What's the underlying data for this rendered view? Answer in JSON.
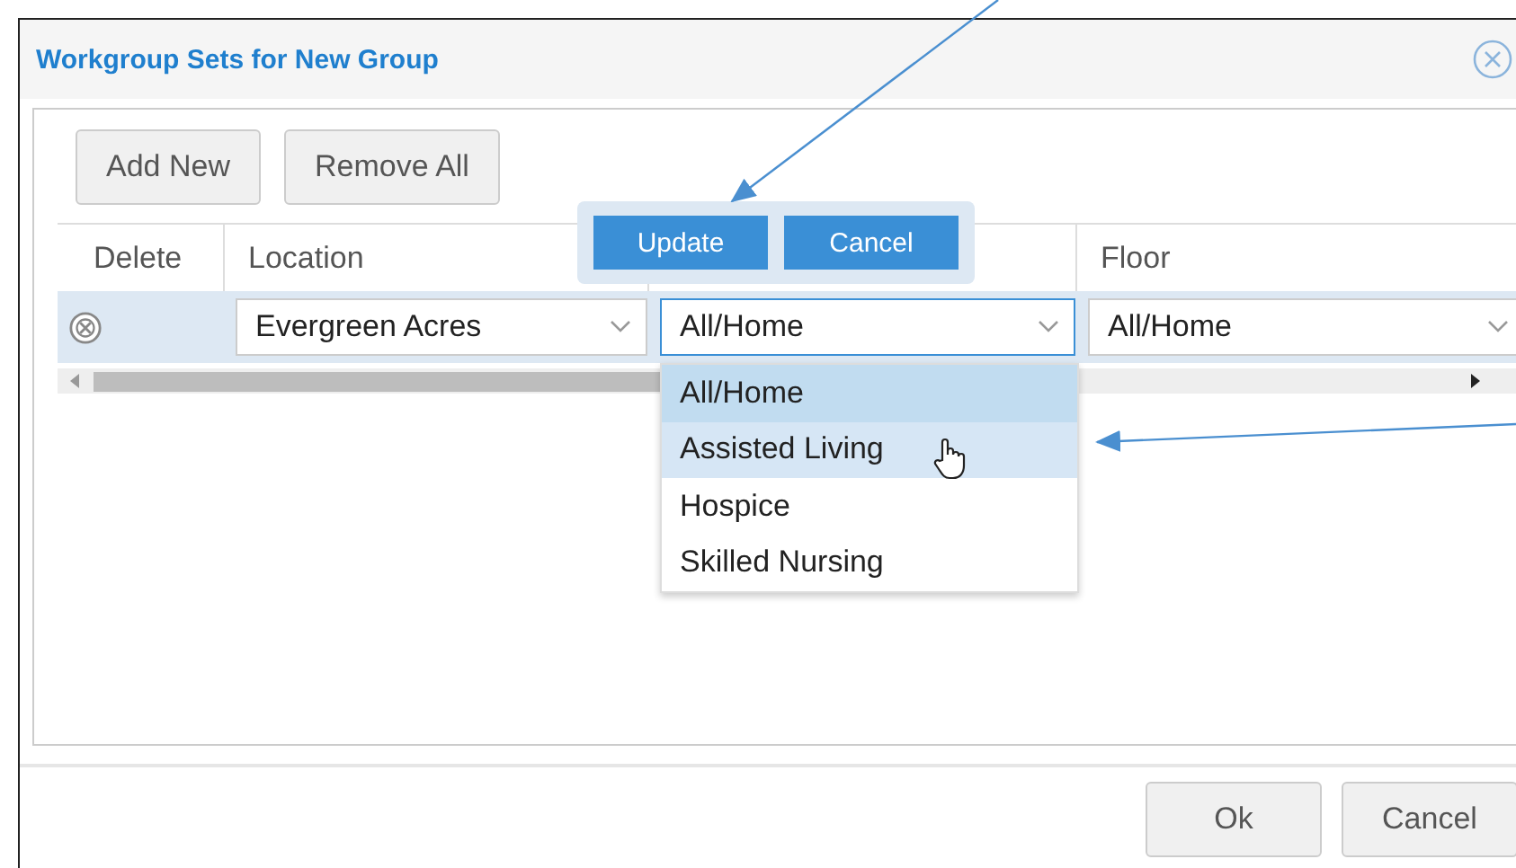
{
  "dialog": {
    "title": "Workgroup Sets for New Group"
  },
  "toolbar": [
    "Add New",
    "Remove All"
  ],
  "table": {
    "columns": [
      {
        "kind": "label",
        "label": "Delete"
      },
      {
        "kind": "label",
        "label": "Location"
      },
      {
        "kind": "covered"
      },
      {
        "kind": "label",
        "label": "Floor"
      }
    ],
    "rows": [
      {
        "selected": true,
        "cells": [
          {
            "kind": "delete"
          },
          {
            "kind": "select",
            "value": "Evergreen Acres",
            "focused": false
          },
          {
            "kind": "select",
            "value": "All/Home",
            "focused": true
          },
          {
            "kind": "select",
            "value": "All/Home",
            "focused": false
          }
        ]
      }
    ]
  },
  "edit_popup": {
    "buttons": [
      "Update",
      "Cancel"
    ]
  },
  "dropdown": {
    "options": [
      {
        "label": "All/Home",
        "selected": true,
        "hovered": false
      },
      {
        "label": "Assisted Living",
        "selected": false,
        "hovered": true
      },
      {
        "label": "Hospice",
        "selected": false,
        "hovered": false
      },
      {
        "label": "Skilled Nursing",
        "selected": false,
        "hovered": false
      }
    ]
  },
  "footer": {
    "buttons": [
      "Ok",
      "Cancel"
    ]
  }
}
